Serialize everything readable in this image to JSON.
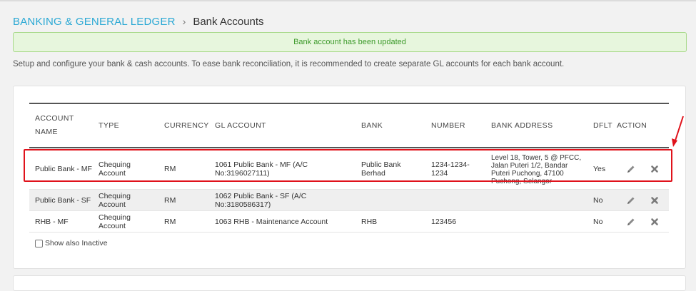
{
  "breadcrumb": {
    "parent": "BANKING & GENERAL LEDGER",
    "separator": "›",
    "current": "Bank Accounts"
  },
  "alert": {
    "message": "Bank account has been updated"
  },
  "description": "Setup and configure your bank & cash accounts. To ease bank reconciliation, it is recommended to create separate GL accounts for each bank account.",
  "table": {
    "headers": {
      "account_name": "ACCOUNT NAME",
      "type": "TYPE",
      "currency": "CURRENCY",
      "gl_account": "GL ACCOUNT",
      "bank": "BANK",
      "number": "NUMBER",
      "bank_address": "BANK ADDRESS",
      "default": "DFLT",
      "action": "ACTION"
    },
    "rows": [
      {
        "account_name": "Public Bank - MF",
        "type": "Chequing Account",
        "currency": "RM",
        "gl_account": "1061 Public Bank - MF (A/C No:3196027111)",
        "bank": "Public Bank Berhad",
        "number": "1234-1234-1234",
        "bank_address": "Level 18, Tower, 5 @ PFCC, Jalan Puteri 1/2, Bandar Puteri Puchong, 47100 Puchong, Selangor",
        "default": "Yes"
      },
      {
        "account_name": "Public Bank - SF",
        "type": "Chequing Account",
        "currency": "RM",
        "gl_account": "1062 Public Bank - SF (A/C No:3180586317)",
        "bank": "",
        "number": "",
        "bank_address": "",
        "default": "No"
      },
      {
        "account_name": "RHB - MF",
        "type": "Chequing Account",
        "currency": "RM",
        "gl_account": "1063 RHB - Maintenance Account",
        "bank": "RHB",
        "number": "123456",
        "bank_address": "",
        "default": "No"
      }
    ],
    "row_actions": {
      "edit_icon": "pencil-icon",
      "delete_icon": "close-icon"
    }
  },
  "show_inactive": {
    "label": "Show also Inactive",
    "checked": false
  },
  "colors": {
    "link": "#2aa8d4",
    "alert_bg": "#e7f6dd",
    "alert_text": "#3c9a2a",
    "highlight": "#e0121b"
  }
}
